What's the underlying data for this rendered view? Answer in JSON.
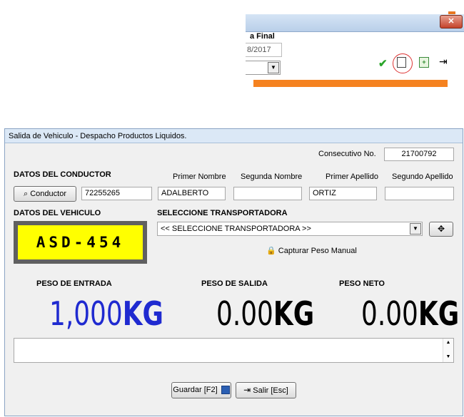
{
  "background_window": {
    "close_symbol": "✕",
    "column_label": "a Final",
    "date_fragment": "8/2017",
    "icons": [
      "check-icon",
      "new-document-icon",
      "export-icon",
      "exit-icon"
    ]
  },
  "dialog": {
    "title": "Salida de Vehiculo - Despacho Productos Liquidos.",
    "consecutivo_label": "Consecutivo No.",
    "consecutivo_value": "21700792",
    "conductor_section": "DATOS DEL CONDUCTOR",
    "conductor_button": "Conductor",
    "conductor_id": "72255265",
    "name_headers": {
      "primer_nombre": "Primer Nombre",
      "segunda_nombre": "Segunda Nombre",
      "primer_apellido": "Primer Apellido",
      "segundo_apellido": "Segundo Apellido"
    },
    "name_values": {
      "primer_nombre": "ADALBERTO",
      "segunda_nombre": "",
      "primer_apellido": "ORTIZ",
      "segundo_apellido": ""
    },
    "vehiculo_section": "DATOS DEL VEHICULO",
    "plate": "ASD-454",
    "transportadora_section": "SELECCIONE TRANSPORTADORA",
    "transportadora_value": "<< SELECCIONE TRANSPORTADORA >>",
    "capturar_label": "Capturar Peso Manual",
    "weights": {
      "entrada_label": "PESO DE ENTRADA",
      "entrada_value": "1,000",
      "salida_label": "PESO DE SALIDA",
      "salida_value": "0.00",
      "neto_label": "PESO NETO",
      "neto_value": "0.00",
      "unit": "KG"
    },
    "notes_value": "",
    "guardar_button": "Guardar [F2]",
    "salir_button": "Salir [Esc]"
  },
  "colors": {
    "plate_background": "#ffff00",
    "entrada_color": "#1f2ad0",
    "orange_bar": "#f58220"
  }
}
